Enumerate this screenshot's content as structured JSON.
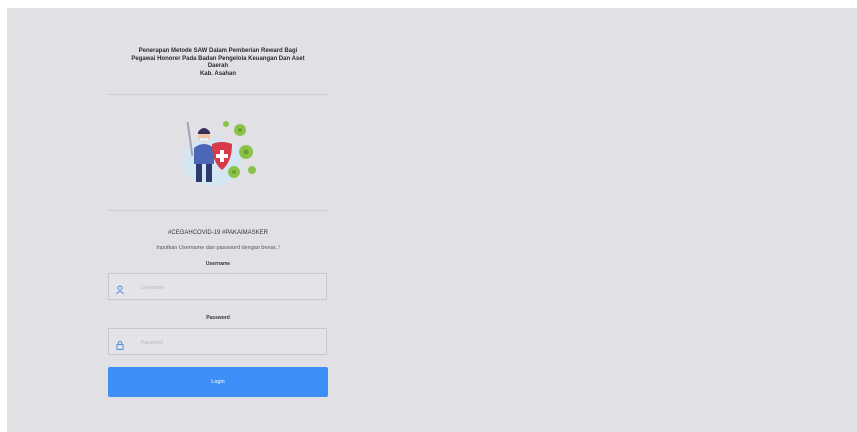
{
  "header": {
    "title_lines": [
      "Penerapan Metode SAW Dalam Pemberian Reward Bagi",
      "Pegawai Honorer Pada Badan Pengelola Keuangan Dan Aset",
      "Daerah",
      "Kab. Asahan"
    ]
  },
  "hashtag": "#CEGAHCOVID-19 #PAKAIMASKER",
  "instruction": "Inputkan Username dan password dengan benar..!",
  "username": {
    "label": "Username",
    "placeholder": "Username",
    "value": "",
    "icon": "user-icon"
  },
  "password": {
    "label": "Password",
    "placeholder": "Password",
    "value": "",
    "icon": "lock-icon"
  },
  "login_button": {
    "label": "Login"
  },
  "colors": {
    "background": "#e1e0e5",
    "accent": "#3e8ef7",
    "virus": "#8bc34a",
    "shield": "#d83a4a"
  }
}
